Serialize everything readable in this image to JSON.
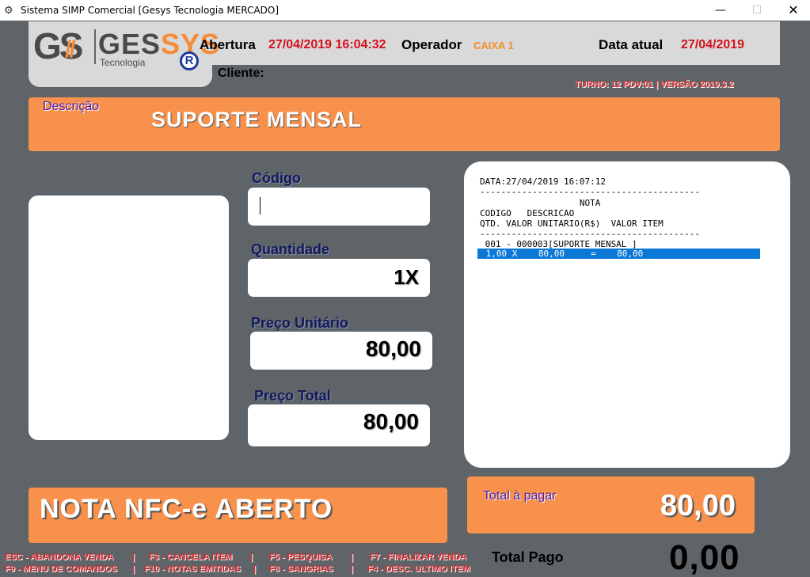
{
  "window": {
    "title": "Sistema SIMP Comercial [Gesys Tecnologia MERCADO]",
    "minimize": "—",
    "maximize": "☐",
    "close": "✕"
  },
  "logo": {
    "gs": "GS",
    "name_main": "GESSYS",
    "subtitle": "Tecnologia",
    "registered": "R"
  },
  "header": {
    "abertura_label": "Abertura",
    "abertura_value": "27/04/2019 16:04:32",
    "operador_label": "Operador",
    "operador_value": "CAIXA 1",
    "data_atual_label": "Data atual",
    "data_atual_value": "27/04/2019",
    "cliente_label": "Cliente:",
    "turno_info": "TURNO: 12 PDV:01 |  VERSÃO 2019.3.2"
  },
  "description": {
    "label": "Descrição",
    "value": "SUPORTE MENSAL"
  },
  "fields": {
    "codigo_label": "Código",
    "codigo_value": "",
    "quantidade_label": "Quantidade",
    "quantidade_value": "1X",
    "preco_unitario_label": "Preço Unitário",
    "preco_unitario_value": "80,00",
    "preco_total_label": "Preço Total",
    "preco_total_value": "80,00"
  },
  "receipt": {
    "lines": [
      "DATA:27/04/2019 16:07:12",
      "------------------------------------------",
      "                   NOTA",
      "CODIGO   DESCRICAO",
      "QTD. VALOR UNITARIO(R$)  VALOR ITEM",
      "------------------------------------------",
      " 001 - 000003[SUPORTE MENSAL ]"
    ],
    "selected_line": " 1,00 X    80,00     =    80,00"
  },
  "status": {
    "text": "NOTA NFC-e ABERTO"
  },
  "totals": {
    "pagar_label": "Total à pagar",
    "pagar_value": "80,00",
    "pago_label": "Total Pago",
    "pago_value": "0,00"
  },
  "shortcuts": {
    "row1": [
      "ESC - ABANDONA VENDA",
      "|",
      "F3 - CANCELA ITEM",
      "|",
      "F5 - PESQUISA",
      "|",
      "F7 - FINALIZAR VENDA"
    ],
    "row2": [
      "F9 - MENU DE COMANDOS",
      "|",
      "F10 - NOTAS EMITIDAS",
      "|",
      "F8 - SANGRIAS",
      "|",
      "F4 - DESC. ULTIMO ITEM"
    ]
  },
  "colors": {
    "background": "#5f6468",
    "accent_orange": "#f8914b",
    "red_value": "#d4111c",
    "selection_blue": "#0b78d7"
  }
}
